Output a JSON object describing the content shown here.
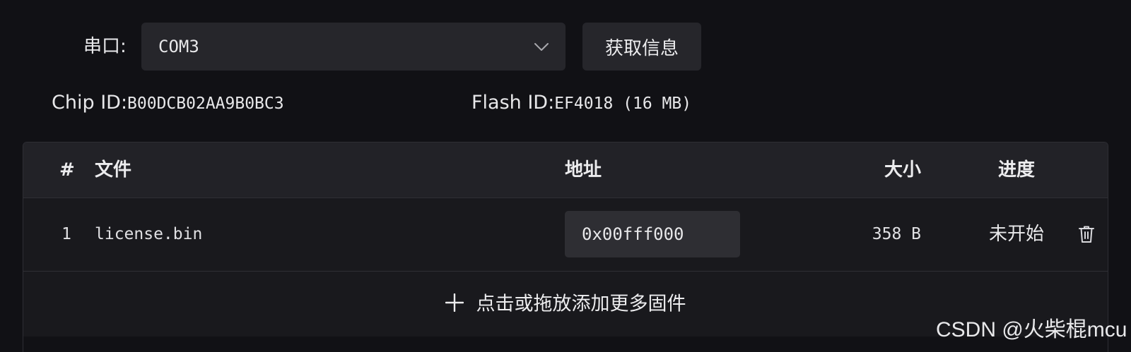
{
  "port": {
    "label": "串口:",
    "selected": "COM3",
    "fetch_button_label": "获取信息"
  },
  "info": {
    "chip_id_label": "Chip ID:",
    "chip_id_value": "B00DCB02AA9B0BC3",
    "flash_id_label": "Flash ID:",
    "flash_id_value": "EF4018 (16 MB)"
  },
  "table": {
    "headers": {
      "num": "#",
      "file": "文件",
      "address": "地址",
      "size": "大小",
      "progress": "进度"
    },
    "rows": [
      {
        "num": "1",
        "file": "license.bin",
        "address": "0x00fff000",
        "size": "358 B",
        "progress": "未开始"
      }
    ],
    "add_label": "点击或拖放添加更多固件"
  },
  "icons": {
    "select": "chevron-down-icon",
    "delete": "trash-icon",
    "add": "plus-icon"
  },
  "watermark": "CSDN @火柴棍mcu"
}
